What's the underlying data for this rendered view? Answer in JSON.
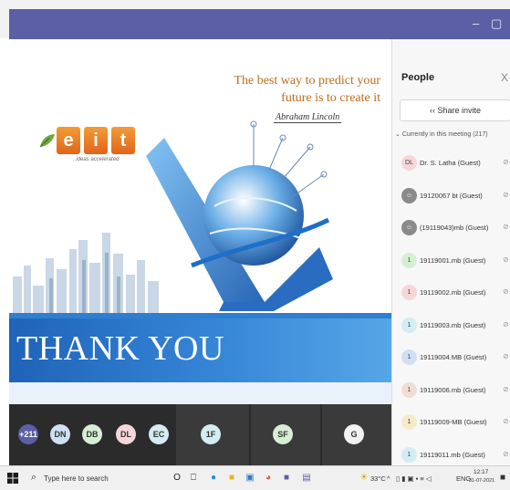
{
  "window": {
    "minimize_glyph": "–",
    "maximize_glyph": "▢",
    "close_glyph": "✕"
  },
  "slide": {
    "quote_line1": "The best way to predict your",
    "quote_line2": "future is to create it",
    "signature": "Abraham Lincoln",
    "logo_letters": [
      "e",
      "i",
      "t"
    ],
    "logo_tagline": "..ideas accelerated",
    "thanks": "THANK YOU"
  },
  "participants_strip": {
    "avatars": [
      {
        "label": "+211",
        "color": "#5b5fa6",
        "text_color": "#ffffff"
      },
      {
        "label": "DN",
        "color": "#cfe0f4",
        "text_color": "#333333"
      },
      {
        "label": "DB",
        "color": "#d6efd4",
        "text_color": "#333333"
      },
      {
        "label": "DL",
        "color": "#f7d6d9",
        "text_color": "#333333"
      },
      {
        "label": "EC",
        "color": "#d4ecf3",
        "text_color": "#333333"
      },
      {
        "label": "1F",
        "color": "#d4ecf3",
        "text_color": "#333333"
      },
      {
        "label": "SF",
        "color": "#d6efd4",
        "text_color": "#333333"
      },
      {
        "label": "G",
        "color": "#f2f2f2",
        "text_color": "#333333"
      }
    ]
  },
  "people_panel": {
    "title": "People",
    "close_glyph": "X",
    "share_label": "Share invite",
    "share_icon": "share-icon",
    "section_label": "Currently in this meeting (217)",
    "participants": [
      {
        "initials": "DL",
        "name": "Dr. S. Latha (Guest)",
        "color": "#f7d6d9"
      },
      {
        "initials": "",
        "name": "19120067 bt (Guest)",
        "color": "#8a8a8a",
        "icon": "person-icon"
      },
      {
        "initials": "",
        "name": "(19119043)mb (Guest)",
        "color": "#8a8a8a",
        "icon": "person-icon"
      },
      {
        "initials": "1",
        "name": "19119001.mb (Guest)",
        "color": "#d6efd4"
      },
      {
        "initials": "1",
        "name": "19119002.mb (Guest)",
        "color": "#f7d6d9"
      },
      {
        "initials": "1",
        "name": "19119003.mb (Guest)",
        "color": "#d4ecf3"
      },
      {
        "initials": "1",
        "name": "19119004.MB (Guest)",
        "color": "#cfe0f4"
      },
      {
        "initials": "1",
        "name": "19119006.mb (Guest)",
        "color": "#f1ddd8"
      },
      {
        "initials": "1",
        "name": "19119009-MB (Guest)",
        "color": "#f7eac9"
      },
      {
        "initials": "1",
        "name": "19119011.mb (Guest)",
        "color": "#d4ecf3"
      }
    ]
  },
  "taskbar": {
    "search_placeholder": "Type here to search",
    "temperature": "33°C",
    "language": "ENG",
    "time": "12:17",
    "date": "31-07-2021"
  }
}
